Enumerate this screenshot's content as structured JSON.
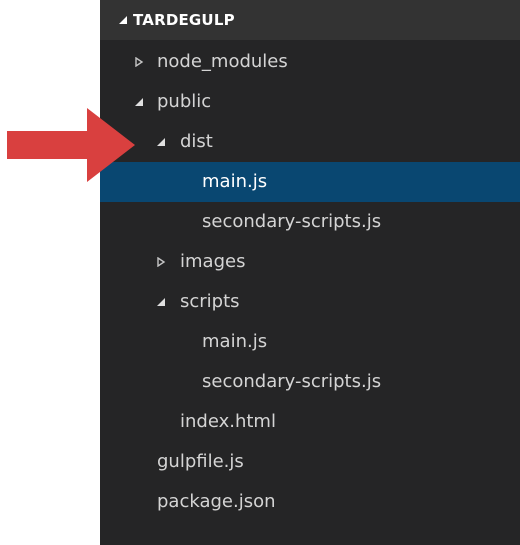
{
  "explorer": {
    "root_label": "TARDEGULP",
    "items": [
      {
        "label": "node_modules",
        "type": "folder",
        "expanded": false,
        "depth": 1
      },
      {
        "label": "public",
        "type": "folder",
        "expanded": true,
        "depth": 1
      },
      {
        "label": "dist",
        "type": "folder",
        "expanded": true,
        "depth": 2
      },
      {
        "label": "main.js",
        "type": "file",
        "depth": 3,
        "selected": true
      },
      {
        "label": "secondary-scripts.js",
        "type": "file",
        "depth": 3
      },
      {
        "label": "images",
        "type": "folder",
        "expanded": false,
        "depth": 2
      },
      {
        "label": "scripts",
        "type": "folder",
        "expanded": true,
        "depth": 2
      },
      {
        "label": "main.js",
        "type": "file",
        "depth": 3
      },
      {
        "label": "secondary-scripts.js",
        "type": "file",
        "depth": 3
      },
      {
        "label": "index.html",
        "type": "file",
        "depth": 2
      },
      {
        "label": "gulpfile.js",
        "type": "file",
        "depth": 1
      },
      {
        "label": "package.json",
        "type": "file",
        "depth": 1
      }
    ]
  },
  "colors": {
    "panel_background": "#252526",
    "header_background": "#333333",
    "selection": "#094771",
    "arrow": "#d9403f"
  },
  "icons": {
    "expanded": "triangle-down-icon",
    "collapsed": "triangle-right-icon",
    "pointer": "red-arrow-icon"
  }
}
